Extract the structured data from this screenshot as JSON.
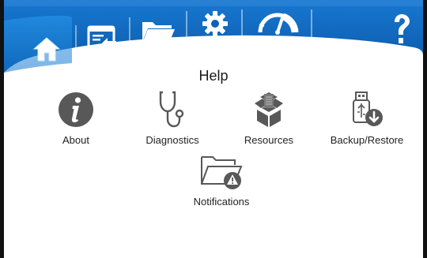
{
  "toolbar": {
    "buttons": [
      {
        "icon": "home-icon"
      },
      {
        "icon": "screen-return-icon"
      },
      {
        "icon": "folder-icon"
      },
      {
        "icon": "gear-icon"
      },
      {
        "icon": "gauge-icon"
      },
      {
        "icon": "question-icon"
      }
    ],
    "colors": {
      "bar_top": "#0f6fc8",
      "bar_bottom": "#0a4f96",
      "active_tab": "#1c88e0",
      "icon": "#ffffff"
    }
  },
  "page": {
    "title": "Help"
  },
  "items": [
    {
      "label": "About",
      "icon": "info-icon"
    },
    {
      "label": "Diagnostics",
      "icon": "stethoscope-icon"
    },
    {
      "label": "Resources",
      "icon": "boxes-icon"
    },
    {
      "label": "Backup/Restore",
      "icon": "usb-download-icon"
    },
    {
      "label": "Notifications",
      "icon": "folder-alert-icon"
    }
  ],
  "icon_color": "#555555"
}
